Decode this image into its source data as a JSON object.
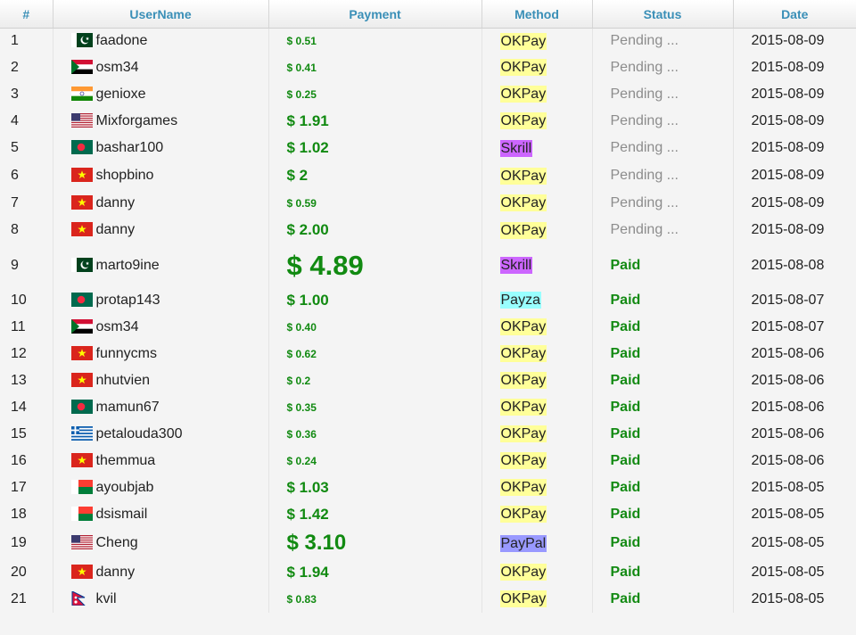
{
  "table": {
    "headers": [
      "#",
      "UserName",
      "Payment",
      "Method",
      "Status",
      "Date"
    ],
    "rows": [
      {
        "n": "1",
        "user": "faadone",
        "flag": "pakistan-flag",
        "amount": "$ 0.51",
        "size": "s",
        "method": "OKPay",
        "status": "Pending ...",
        "date": "2015-08-09"
      },
      {
        "n": "2",
        "user": "osm34",
        "flag": "sudan-flag",
        "amount": "$ 0.41",
        "size": "s",
        "method": "OKPay",
        "status": "Pending ...",
        "date": "2015-08-09"
      },
      {
        "n": "3",
        "user": "genioxe",
        "flag": "india-flag",
        "amount": "$ 0.25",
        "size": "s",
        "method": "OKPay",
        "status": "Pending ...",
        "date": "2015-08-09"
      },
      {
        "n": "4",
        "user": "Mixforgames",
        "flag": "usa-flag",
        "amount": "$ 1.91",
        "size": "m",
        "method": "OKPay",
        "status": "Pending ...",
        "date": "2015-08-09"
      },
      {
        "n": "5",
        "user": "bashar100",
        "flag": "bangladesh-flag",
        "amount": "$ 1.02",
        "size": "m",
        "method": "Skrill",
        "status": "Pending ...",
        "date": "2015-08-09"
      },
      {
        "n": "6",
        "user": "shopbino",
        "flag": "vietnam-flag",
        "amount": "$ 2",
        "size": "m",
        "method": "OKPay",
        "status": "Pending ...",
        "date": "2015-08-09"
      },
      {
        "n": "7",
        "user": "danny",
        "flag": "vietnam-flag",
        "amount": "$ 0.59",
        "size": "s",
        "method": "OKPay",
        "status": "Pending ...",
        "date": "2015-08-09"
      },
      {
        "n": "8",
        "user": "danny",
        "flag": "vietnam-flag",
        "amount": "$ 2.00",
        "size": "m",
        "method": "OKPay",
        "status": "Pending ...",
        "date": "2015-08-09"
      },
      {
        "n": "9",
        "user": "marto9ine",
        "flag": "pakistan-flag",
        "amount": "$ 4.89",
        "size": "xl",
        "method": "Skrill",
        "status": "Paid",
        "date": "2015-08-08"
      },
      {
        "n": "10",
        "user": "protap143",
        "flag": "bangladesh-flag",
        "amount": "$ 1.00",
        "size": "m",
        "method": "Payza",
        "status": "Paid",
        "date": "2015-08-07"
      },
      {
        "n": "11",
        "user": "osm34",
        "flag": "sudan-flag",
        "amount": "$ 0.40",
        "size": "s",
        "method": "OKPay",
        "status": "Paid",
        "date": "2015-08-07"
      },
      {
        "n": "12",
        "user": "funnycms",
        "flag": "vietnam-flag",
        "amount": "$ 0.62",
        "size": "s",
        "method": "OKPay",
        "status": "Paid",
        "date": "2015-08-06"
      },
      {
        "n": "13",
        "user": "nhutvien",
        "flag": "vietnam-flag",
        "amount": "$ 0.2",
        "size": "s",
        "method": "OKPay",
        "status": "Paid",
        "date": "2015-08-06"
      },
      {
        "n": "14",
        "user": "mamun67",
        "flag": "bangladesh-flag",
        "amount": "$ 0.35",
        "size": "s",
        "method": "OKPay",
        "status": "Paid",
        "date": "2015-08-06"
      },
      {
        "n": "15",
        "user": "petalouda300",
        "flag": "greece-flag",
        "amount": "$ 0.36",
        "size": "s",
        "method": "OKPay",
        "status": "Paid",
        "date": "2015-08-06"
      },
      {
        "n": "16",
        "user": "themmua",
        "flag": "vietnam-flag",
        "amount": "$ 0.24",
        "size": "s",
        "method": "OKPay",
        "status": "Paid",
        "date": "2015-08-06"
      },
      {
        "n": "17",
        "user": "ayoubjab",
        "flag": "madagascar-flag",
        "amount": "$ 1.03",
        "size": "m",
        "method": "OKPay",
        "status": "Paid",
        "date": "2015-08-05"
      },
      {
        "n": "18",
        "user": "dsismail",
        "flag": "madagascar-flag",
        "amount": "$ 1.42",
        "size": "m",
        "method": "OKPay",
        "status": "Paid",
        "date": "2015-08-05"
      },
      {
        "n": "19",
        "user": "Cheng",
        "flag": "usa-flag",
        "amount": "$ 3.10",
        "size": "l",
        "method": "PayPal",
        "status": "Paid",
        "date": "2015-08-05"
      },
      {
        "n": "20",
        "user": "danny",
        "flag": "vietnam-flag",
        "amount": "$ 1.94",
        "size": "m",
        "method": "OKPay",
        "status": "Paid",
        "date": "2015-08-05"
      },
      {
        "n": "21",
        "user": "kvil",
        "flag": "nepal-flag",
        "amount": "$ 0.83",
        "size": "s",
        "method": "OKPay",
        "status": "Paid",
        "date": "2015-08-05"
      }
    ]
  },
  "colors": {
    "header_text": "#3a8fb7",
    "amount_green": "#118a11",
    "okpay_highlight": "#ffff99",
    "skrill_highlight": "#cc66ff",
    "payza_highlight": "#99ffff",
    "paypal_highlight": "#9999ff"
  }
}
